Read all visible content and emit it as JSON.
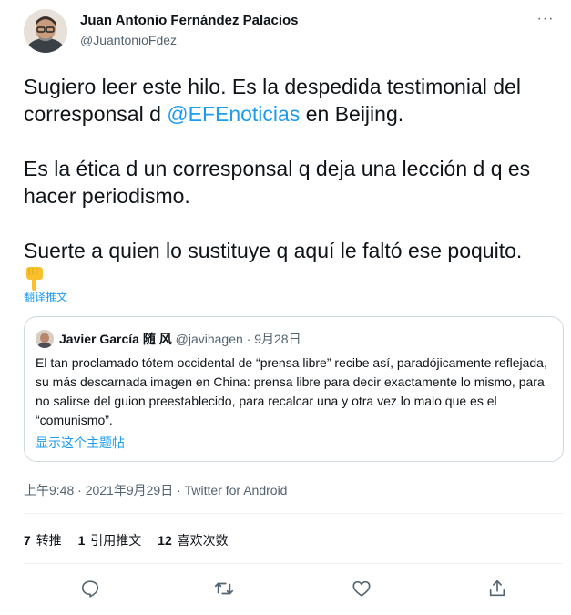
{
  "author": {
    "name": "Juan Antonio Fernández Palacios",
    "handle": "@JuantonioFdez",
    "avatar_icon": "avatar-photo-icon"
  },
  "more_icon": "more-dots-icon",
  "tweet": {
    "line1_pre": "Sugiero leer este hilo. Es la despedida testimonial del corresponsal d ",
    "mention": "@EFEnoticias",
    "line1_post": " en Beijing.",
    "para2": "Es la ética d un corresponsal q deja una lección d q es hacer periodismo.",
    "para3": "Suerte a quien lo sustituye q aquí le faltó ese poquito.",
    "emoji_icon": "pointing-down-hand-icon",
    "translate_label": "翻译推文"
  },
  "quoted": {
    "name": "Javier García 随 风",
    "handle": "@javihagen",
    "date": "· 9月28日",
    "text": "El tan proclamado tótem occidental de “prensa libre” recibe así, paradójicamente reflejada, su más descarnada imagen en China: prensa libre para decir exactamente lo mismo, para no salirse del guion preestablecido, para recalcar una y otra vez lo malo que es el “comunismo”.",
    "show_thread": "显示这个主题帖"
  },
  "meta": {
    "time": "上午9:48 · 2021年9月29日 · ",
    "source": "Twitter for Android"
  },
  "stats": [
    {
      "num": "7",
      "label": "转推"
    },
    {
      "num": "1",
      "label": "引用推文"
    },
    {
      "num": "12",
      "label": "喜欢次数"
    }
  ],
  "actions": [
    "reply-icon",
    "retweet-icon",
    "like-icon",
    "share-icon"
  ],
  "colors": {
    "accent": "#1d9bf0",
    "text": "#0f1419",
    "secondary": "#536471",
    "border": "#cfd9de"
  }
}
